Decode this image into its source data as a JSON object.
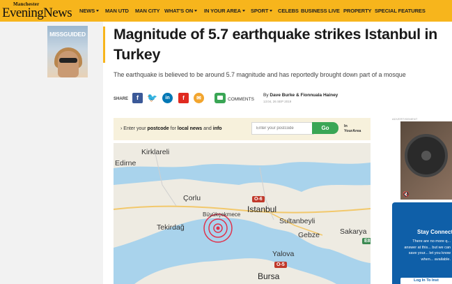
{
  "header": {
    "logo_small": "Manchester",
    "logo_big": "EveningNews",
    "nav": [
      {
        "label": "NEWS",
        "dropdown": true
      },
      {
        "label": "MAN UTD",
        "dropdown": false
      },
      {
        "label": "MAN CITY",
        "dropdown": false
      },
      {
        "label": "WHAT'S ON",
        "dropdown": true
      },
      {
        "label": "IN YOUR AREA",
        "dropdown": true
      },
      {
        "label": "SPORT",
        "dropdown": true
      },
      {
        "label": "CELEBS",
        "dropdown": false
      },
      {
        "label": "BUSINESS LIVE",
        "dropdown": false
      },
      {
        "label": "PROPERTY",
        "dropdown": false
      },
      {
        "label": "SPECIAL FEATURES",
        "dropdown": false
      }
    ]
  },
  "left_ad": {
    "brand": "MISSGUIDED"
  },
  "article": {
    "headline": "Magnitude of 5.7 earthquake strikes Istanbul in Turkey",
    "standfirst": "The earthquake is believed to be around 5.7 magnitude and has reportedly brought down part of a mosque",
    "share_label": "SHARE",
    "comments_label": "COMMENTS",
    "byline_prefix": "By",
    "authors": "Dave Burke & Fionnuala Hainey",
    "date": "13:04, 26 SEP 2019"
  },
  "postcode": {
    "prompt_prefix": "Enter your",
    "prompt_bold1": "postcode",
    "prompt_mid": "for",
    "prompt_bold2": "local news",
    "prompt_and": "and",
    "prompt_bold3": "info",
    "placeholder": "Enter your postcode",
    "go_label": "Go",
    "brand_line1": "In",
    "brand_line2": "YourArea"
  },
  "map": {
    "cities": [
      "Kirklareli",
      "Edirne",
      "Çorlu",
      "Büyükçekmece",
      "Istanbul",
      "Sultanbeyli",
      "Tekirdağ",
      "Gebze",
      "Sakarya",
      "Yalova",
      "Bursa"
    ],
    "roads": [
      "O-6",
      "O-5",
      "E8"
    ],
    "colors": {
      "land": "#eeebe2",
      "sea": "#a9d3ec",
      "roads": "#c0392b",
      "epicenter": "#e0314b"
    }
  },
  "right": {
    "ad_label": "ADVERTISEMENT",
    "signin_title": "Stay Connect",
    "signin_text": "There are no more q... answer at this... but we can save your... let you know when... available.",
    "login_label": "Log In To Inst"
  }
}
